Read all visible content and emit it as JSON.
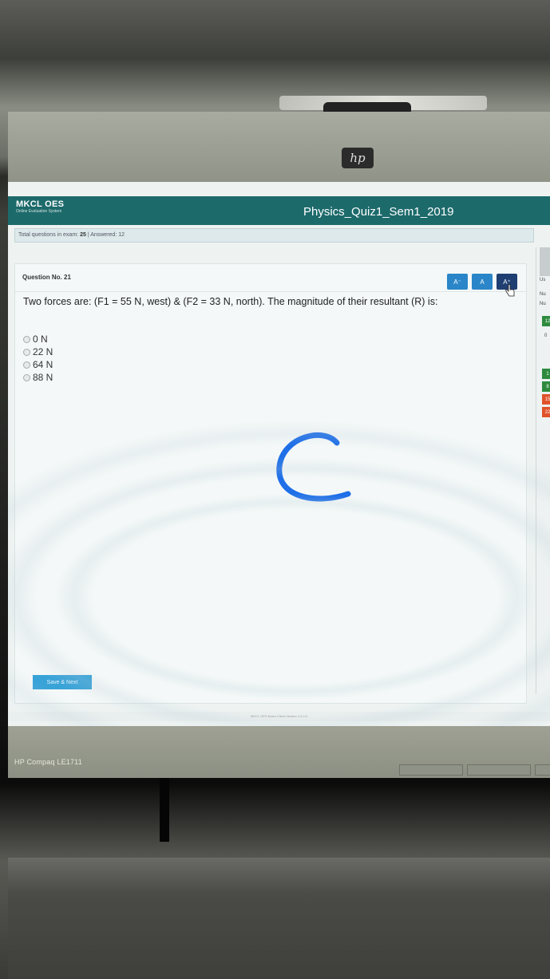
{
  "brand": {
    "name": "MKCL OES",
    "subtitle": "Online Evaluation System"
  },
  "exam": {
    "title": "Physics_Quiz1_Sem1_2019"
  },
  "summary": {
    "total_label": "Total questions in exam:",
    "total_value": "25",
    "answered_label": "| Answered:",
    "answered_value": "12"
  },
  "question": {
    "number_label": "Question No. 21",
    "text": "Two forces are: (F1 = 55 N, west) & (F2 = 33 N, north). The magnitude of their resultant (R) is:",
    "options": [
      "0 N",
      "22 N",
      "64 N",
      "88 N"
    ]
  },
  "font_controls": {
    "decrease": "A⁻",
    "normal": "A",
    "increase": "A⁺",
    "selected": "increase"
  },
  "actions": {
    "save_next": "Save & Next"
  },
  "right_panel": {
    "header": "Us",
    "line1": "Nu",
    "line2": "Nu",
    "stat_chip": "12",
    "stat_text": "0",
    "grid_items": [
      {
        "label": "1",
        "color": "#2e8b3e"
      },
      {
        "label": "8",
        "color": "#2e8b3e"
      },
      {
        "label": "15",
        "color": "#e0522b"
      },
      {
        "label": "22",
        "color": "#e0522b"
      }
    ]
  },
  "footer": {
    "text": "MKCL OES Exam Client Version 4.4.0.0"
  },
  "monitor": {
    "logo": "hp",
    "model": "HP Compaq LE1711"
  },
  "colors": {
    "header": "#1d6a6b",
    "button": "#2a86c8",
    "button_active": "#1f3f72",
    "answered": "#2e8b3e",
    "not_answered": "#e0522b",
    "pen_mark": "#1e6fe8"
  }
}
